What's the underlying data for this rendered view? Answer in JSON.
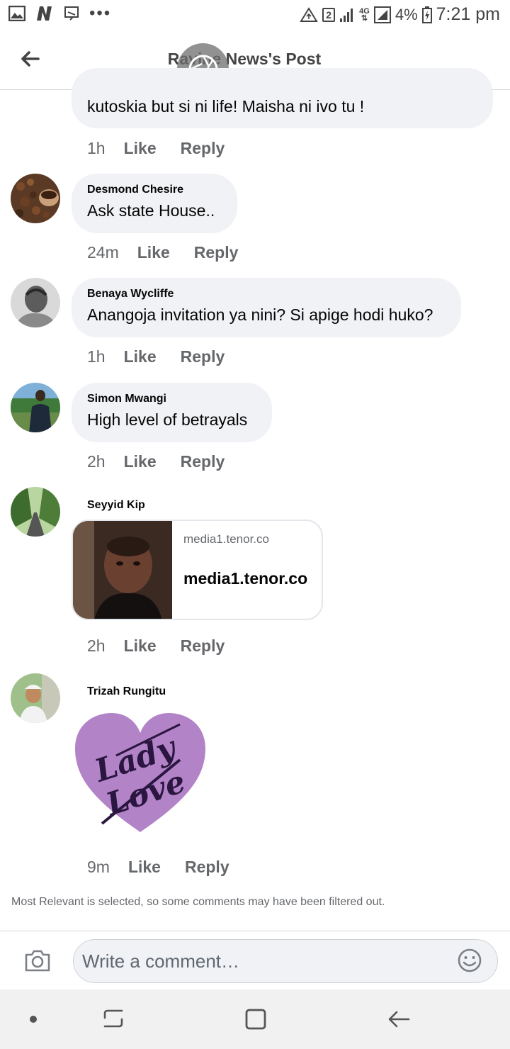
{
  "status_bar": {
    "time": "7:21 pm",
    "battery_percent": "4%",
    "notification_count": "2",
    "network": "4G",
    "more": "•••"
  },
  "header": {
    "title": "Ravine News's Post",
    "back_icon": "arrow-left-icon"
  },
  "comments": [
    {
      "name": "",
      "text_partial": "kutoskia but si ni life! Maisha ni ivo tu !",
      "time": "1h",
      "like": "Like",
      "reply": "Reply"
    },
    {
      "name": "Desmond Chesire",
      "text": "Ask state House..",
      "time": "24m",
      "like": "Like",
      "reply": "Reply"
    },
    {
      "name": "Benaya Wycliffe",
      "text": "Anangoja invitation ya nini? Si apige hodi huko?",
      "time": "1h",
      "like": "Like",
      "reply": "Reply"
    },
    {
      "name": "Simon Mwangi",
      "text": "High level of betrayals",
      "time": "2h",
      "like": "Like",
      "reply": "Reply"
    },
    {
      "name": "Seyyid Kip",
      "link_domain": "media1.tenor.co",
      "link_title": "media1.tenor.co",
      "time": "2h",
      "like": "Like",
      "reply": "Reply"
    },
    {
      "name": "Trizah Rungitu",
      "sticker_text": "Lady Love",
      "time": "9m",
      "like": "Like",
      "reply": "Reply"
    }
  ],
  "filter_note": "Most Relevant is selected, so some comments may have been filtered out.",
  "composer": {
    "placeholder": "Write a comment…",
    "camera_icon": "camera-icon",
    "emoji_icon": "emoji-icon"
  },
  "nav": {
    "items": [
      "dot-icon",
      "recent-apps-icon",
      "home-icon",
      "back-icon"
    ]
  },
  "colors": {
    "bubble": "#f0f2f5",
    "secondary_text": "#65676b",
    "sticker_heart": "#b383c8",
    "sticker_text": "#2a1640"
  }
}
